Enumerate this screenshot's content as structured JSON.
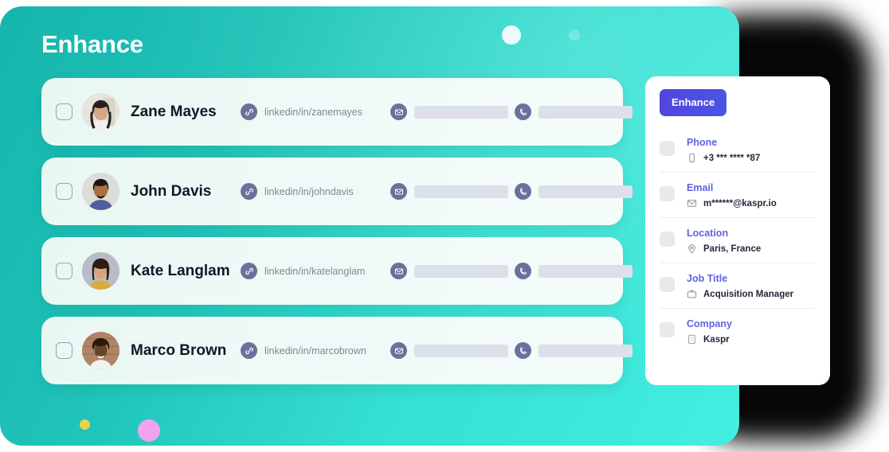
{
  "page": {
    "title": "Enhance",
    "accent_teal": "#1fc3b8",
    "accent_purple": "#5145dd",
    "icon_circle_color": "#6d6f9c",
    "label_color": "#5f63e2"
  },
  "decorations": [
    {
      "name": "circle-large-white",
      "color": "#ffffff"
    },
    {
      "name": "circle-small-white",
      "color": "rgba(255,255,255,0.22)"
    },
    {
      "name": "dot-yellow",
      "color": "#ecd14b"
    },
    {
      "name": "dot-pink",
      "color": "#f2a2ef"
    }
  ],
  "contacts": [
    {
      "name": "Zane Mayes",
      "linkedin": "linkedin/in/zanemayes",
      "email_masked": "",
      "phone_masked": "",
      "selected": false,
      "avatar": "woman-dark-hair"
    },
    {
      "name": "John Davis",
      "linkedin": "linkedin/in/johndavis",
      "email_masked": "",
      "phone_masked": "",
      "selected": false,
      "avatar": "man-beard-blue-shirt"
    },
    {
      "name": "Kate Langlam",
      "linkedin": "linkedin/in/katelanglam",
      "email_masked": "",
      "phone_masked": "",
      "selected": false,
      "avatar": "woman-long-hair"
    },
    {
      "name": "Marco Brown",
      "linkedin": "linkedin/in/marcobrown",
      "email_masked": "",
      "phone_masked": "",
      "selected": false,
      "avatar": "man-curly-hair-white-shirt"
    }
  ],
  "detail_panel": {
    "enhance_label": "Enhance",
    "items": [
      {
        "label": "Phone",
        "value": "+3 *** **** *87",
        "icon": "mobile-icon"
      },
      {
        "label": "Email",
        "value": "m******@kaspr.io",
        "icon": "envelope-icon"
      },
      {
        "label": "Location",
        "value": "Paris, France",
        "icon": "map-pin-icon"
      },
      {
        "label": "Job Title",
        "value": "Acquisition Manager",
        "icon": "briefcase-icon"
      },
      {
        "label": "Company",
        "value": "Kaspr",
        "icon": "building-icon"
      }
    ]
  }
}
